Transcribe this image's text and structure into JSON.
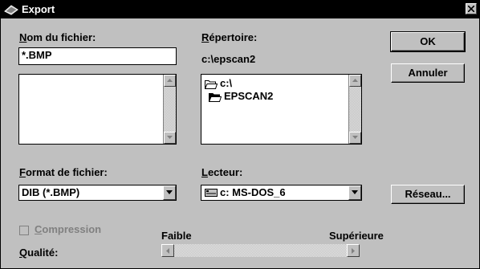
{
  "window": {
    "title": "Export"
  },
  "filename": {
    "label_ul": "N",
    "label_rest": "om du fichier:",
    "value": "*.BMP"
  },
  "directory": {
    "label_ul": "R",
    "label_rest": "épertoire:",
    "current_path": "c:\\epscan2",
    "tree": [
      {
        "label": "c:\\",
        "icon": "folder-open-icon"
      },
      {
        "label": "EPSCAN2",
        "icon": "folder-open-icon"
      }
    ]
  },
  "format": {
    "label_ul": "F",
    "label_rest": "ormat de fichier:",
    "selected": "DIB (*.BMP)"
  },
  "drive": {
    "label_ul": "L",
    "label_rest": "ecteur:",
    "selected": "c: MS-DOS_6",
    "icon": "drive-icon"
  },
  "buttons": {
    "ok": "OK",
    "cancel": "Annuler",
    "network": "Réseau..."
  },
  "compression": {
    "label_ul": "C",
    "label_rest": "ompression",
    "checked": false,
    "enabled": false
  },
  "quality": {
    "label_ul": "Q",
    "label_rest": "ualité:",
    "low": "Faible",
    "high": "Supérieure"
  }
}
